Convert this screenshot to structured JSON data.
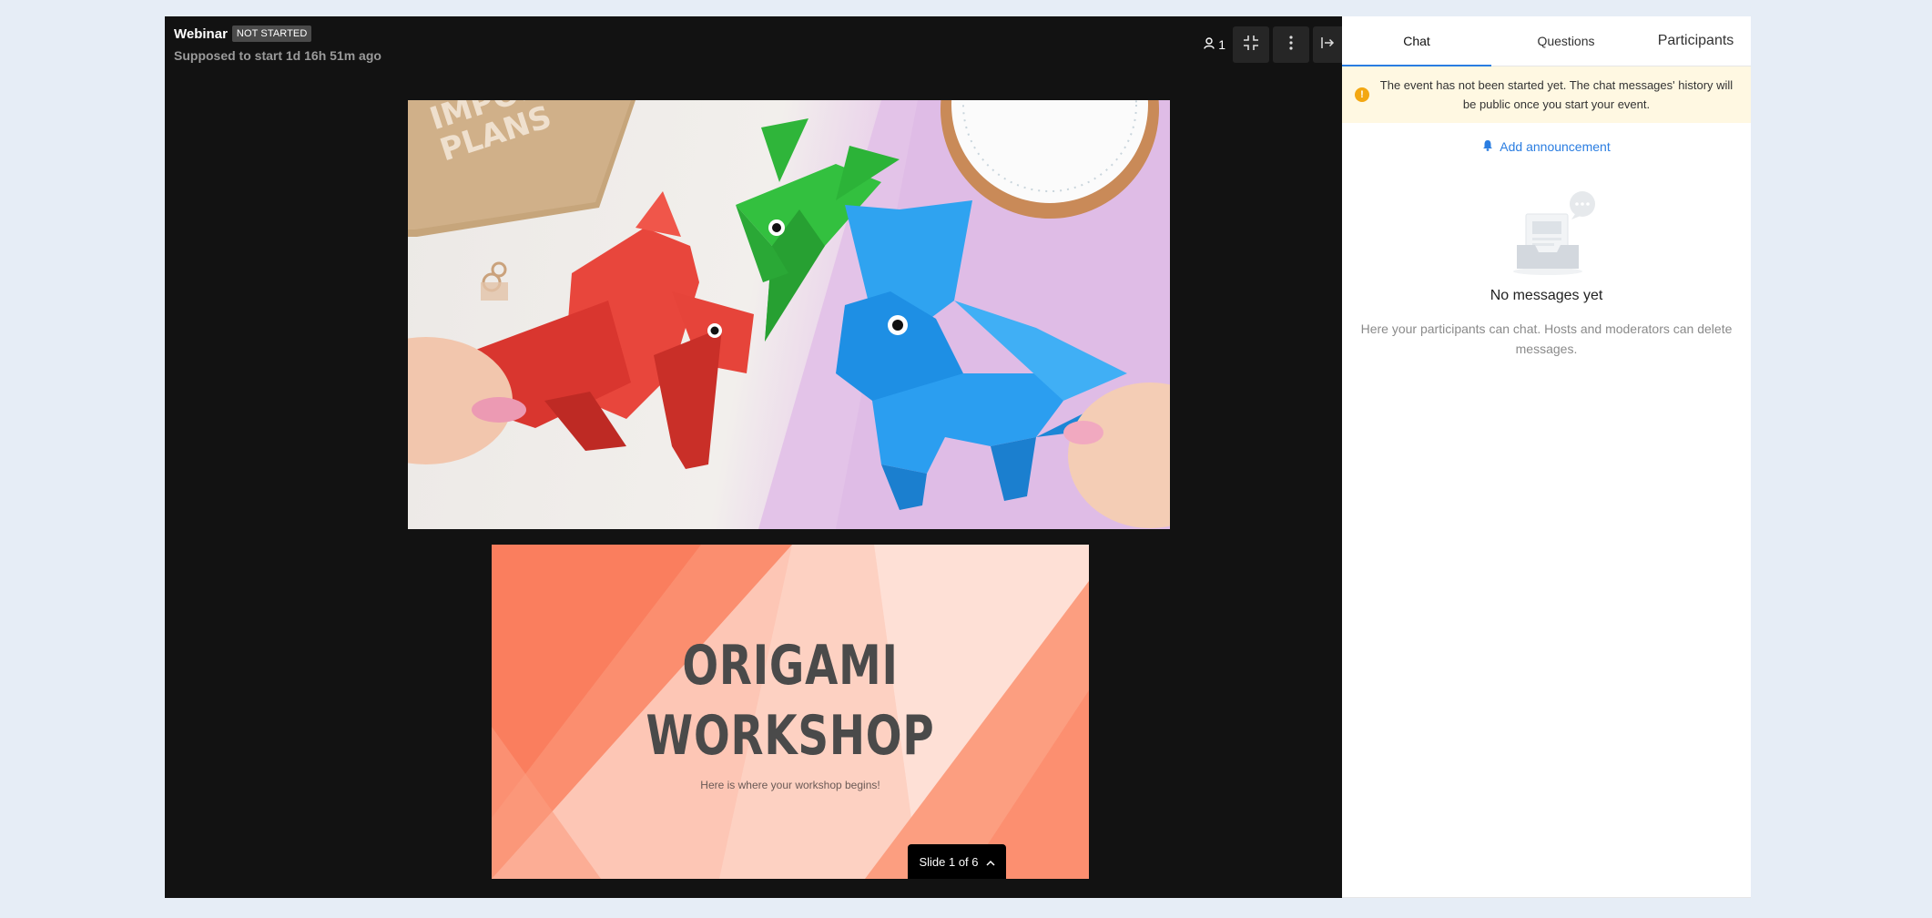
{
  "header": {
    "event_name": "Webinar",
    "status_badge": "NOT STARTED",
    "subtitle": "Supposed to start 1d 16h 51m ago",
    "viewer_count": "1"
  },
  "slide": {
    "title": "ORIGAMI\nWORKSHOP",
    "subtitle": "Here is where your workshop begins!",
    "pager_label": "Slide 1 of 6"
  },
  "video": {
    "book_text": "IMPORTANT\nPLANS"
  },
  "panel": {
    "tabs": [
      {
        "label": "Chat",
        "active": true
      },
      {
        "label": "Questions",
        "active": false
      },
      {
        "label": "Participants",
        "active": false
      }
    ],
    "notice": "The event has not been started yet. The chat messages' history will be public once you start your event.",
    "add_announcement": "Add announcement",
    "empty_title": "No messages yet",
    "empty_desc": "Here your participants can chat. Hosts and moderators can delete messages."
  },
  "colors": {
    "accent": "#2a7de1",
    "warning": "#f3a712",
    "stage_bg": "#121212",
    "slide_bg": "#fdc6b5"
  },
  "icons": [
    "user-icon",
    "collapse-icon",
    "more-vertical-icon",
    "exit-panel-icon",
    "warning-icon",
    "bell-icon",
    "chevron-up-icon",
    "inbox-illustration"
  ]
}
